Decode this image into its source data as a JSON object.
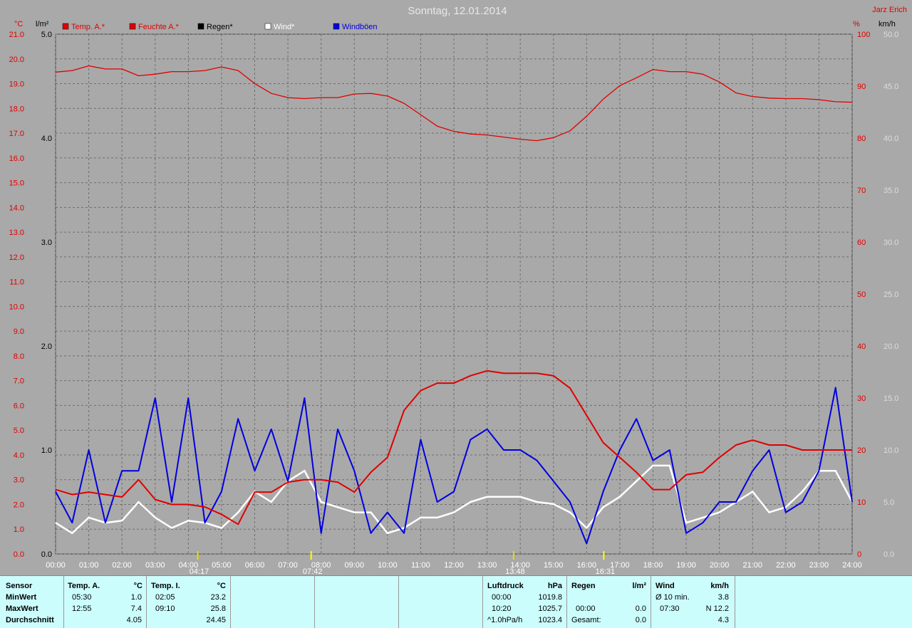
{
  "title": "Sonntag, 12.01.2014",
  "author": "Jarz Erich",
  "units": {
    "temp": "°C",
    "rain": "l/m²",
    "humidity": "%",
    "wind": "km/h"
  },
  "legend": [
    {
      "label": "Temp. A.*",
      "color": "#e00000"
    },
    {
      "label": "Feuchte A.*",
      "color": "#e00000"
    },
    {
      "label": "Regen*",
      "color": "#000000"
    },
    {
      "label": "Wind*",
      "color": "#ffffff"
    },
    {
      "label": "Windböen",
      "color": "#0000e0"
    }
  ],
  "markers": {
    "moonrise": "04:17",
    "sunrise": "07:42",
    "moonset": "13:48",
    "sunset": "16:31"
  },
  "chart_data": {
    "type": "line",
    "x_ticks": [
      "00:00",
      "01:00",
      "02:00",
      "03:00",
      "04:00",
      "05:00",
      "06:00",
      "07:00",
      "08:00",
      "09:00",
      "10:00",
      "11:00",
      "12:00",
      "13:00",
      "14:00",
      "15:00",
      "16:00",
      "17:00",
      "18:00",
      "19:00",
      "20:00",
      "21:00",
      "22:00",
      "23:00",
      "24:00"
    ],
    "axes": {
      "temp": {
        "min": 0,
        "max": 21,
        "step": 1,
        "ticks": [
          "0.0",
          "1.0",
          "2.0",
          "3.0",
          "4.0",
          "5.0",
          "6.0",
          "7.0",
          "8.0",
          "9.0",
          "10.0",
          "11.0",
          "12.0",
          "13.0",
          "14.0",
          "15.0",
          "16.0",
          "17.0",
          "18.0",
          "19.0",
          "20.0",
          "21.0"
        ]
      },
      "rain": {
        "min": 0,
        "max": 5,
        "ticks": [
          "0.0",
          "1.0",
          "2.0",
          "3.0",
          "4.0",
          "5.0"
        ]
      },
      "humidity": {
        "min": 0,
        "max": 100,
        "ticks": [
          "0",
          "10",
          "20",
          "30",
          "40",
          "50",
          "60",
          "70",
          "80",
          "90",
          "100"
        ]
      },
      "wind": {
        "min": 0,
        "max": 50,
        "ticks": [
          "0.0",
          "5.0",
          "10.0",
          "15.0",
          "20.0",
          "25.0",
          "30.0",
          "35.0",
          "40.0",
          "45.0",
          "50.0"
        ]
      }
    },
    "series": [
      {
        "name": "Temp. A.*",
        "axis": "temp",
        "color": "#e00000",
        "x": [
          0,
          0.5,
          1,
          1.5,
          2,
          2.5,
          3,
          3.5,
          4,
          4.5,
          5,
          5.5,
          6,
          6.5,
          7,
          7.5,
          8,
          8.5,
          9,
          9.5,
          10,
          10.5,
          11,
          11.5,
          12,
          12.5,
          13,
          13.5,
          14,
          14.5,
          15,
          15.5,
          16,
          16.5,
          17,
          17.5,
          18,
          18.5,
          19,
          19.5,
          20,
          20.5,
          21,
          21.5,
          22,
          22.5,
          23,
          23.5,
          24
        ],
        "values": [
          2.6,
          2.4,
          2.5,
          2.4,
          2.3,
          3.0,
          2.2,
          2.0,
          2.0,
          1.9,
          1.6,
          1.2,
          2.5,
          2.5,
          2.9,
          3.0,
          3.0,
          2.9,
          2.5,
          3.3,
          3.9,
          5.8,
          6.6,
          6.9,
          6.9,
          7.2,
          7.4,
          7.3,
          7.3,
          7.3,
          7.2,
          6.7,
          5.6,
          4.5,
          3.9,
          3.3,
          2.6,
          2.6,
          3.2,
          3.3,
          3.9,
          4.4,
          4.6,
          4.4,
          4.4,
          4.2,
          4.2,
          4.2,
          4.2
        ]
      },
      {
        "name": "Feuchte A.*",
        "axis": "humidity",
        "color": "#e00000",
        "x": [
          0,
          0.5,
          1,
          1.5,
          2,
          2.5,
          3,
          3.5,
          4,
          4.5,
          5,
          5.5,
          6,
          6.5,
          7,
          7.5,
          8,
          8.5,
          9,
          9.5,
          10,
          10.5,
          11,
          11.5,
          12,
          12.5,
          13,
          13.5,
          14,
          14.5,
          15,
          15.5,
          16,
          16.5,
          17,
          17.5,
          18,
          18.5,
          19,
          19.5,
          20,
          20.5,
          21,
          21.5,
          22,
          22.5,
          23,
          23.5,
          24
        ],
        "values": [
          92.7,
          93,
          93.9,
          93.3,
          93.3,
          92,
          92.3,
          92.8,
          92.8,
          93,
          93.7,
          93,
          90.5,
          88.6,
          87.8,
          87.6,
          87.8,
          87.8,
          88.5,
          88.6,
          88.1,
          86.7,
          84.5,
          82.3,
          81.3,
          80.8,
          80.6,
          80.2,
          79.8,
          79.5,
          80.1,
          81.4,
          84.2,
          87.5,
          90.1,
          91.6,
          93.2,
          92.8,
          92.8,
          92.3,
          90.8,
          88.7,
          88.0,
          87.7,
          87.6,
          87.6,
          87.4,
          87.0,
          86.9
        ]
      },
      {
        "name": "Wind*",
        "axis": "wind",
        "color": "#ffffff",
        "x": [
          0,
          0.5,
          1,
          1.5,
          2,
          2.5,
          3,
          3.5,
          4,
          4.5,
          5,
          5.5,
          6,
          6.5,
          7,
          7.5,
          8,
          8.5,
          9,
          9.5,
          10,
          10.5,
          11,
          11.5,
          12,
          12.5,
          13,
          13.5,
          14,
          14.5,
          15,
          15.5,
          16,
          16.5,
          17,
          17.5,
          18,
          18.5,
          19,
          19.5,
          20,
          20.5,
          21,
          21.5,
          22,
          22.5,
          23,
          23.5,
          24
        ],
        "values": [
          3,
          2,
          3.5,
          3,
          3.2,
          5,
          3.5,
          2.5,
          3.2,
          3,
          2.5,
          4,
          6,
          5,
          7,
          8,
          5,
          4.5,
          4,
          4,
          2,
          2.5,
          3.5,
          3.5,
          4,
          5,
          5.5,
          5.5,
          5.5,
          5,
          4.8,
          4,
          2.5,
          4.5,
          5.5,
          7,
          8.5,
          8.5,
          3,
          3.5,
          4,
          5,
          6,
          4,
          4.5,
          6,
          8,
          8,
          5
        ]
      },
      {
        "name": "Windböen",
        "axis": "wind",
        "color": "#0000e0",
        "x": [
          0,
          0.5,
          1,
          1.5,
          2,
          2.5,
          3,
          3.5,
          4,
          4.5,
          5,
          5.5,
          6,
          6.5,
          7,
          7.5,
          8,
          8.5,
          9,
          9.5,
          10,
          10.5,
          11,
          11.5,
          12,
          12.5,
          13,
          13.5,
          14,
          14.5,
          15,
          15.5,
          16,
          16.5,
          17,
          17.5,
          18,
          18.5,
          19,
          19.5,
          20,
          20.5,
          21,
          21.5,
          22,
          22.5,
          23,
          23.5,
          24
        ],
        "values": [
          6,
          3,
          10,
          3,
          8,
          8,
          15,
          5,
          15,
          3,
          6,
          13,
          8,
          12,
          7,
          15,
          2,
          12,
          8,
          2,
          4,
          2,
          11,
          5,
          6,
          11,
          12,
          10,
          10,
          9,
          7,
          5,
          1,
          6,
          10,
          13,
          9,
          10,
          2,
          3,
          5,
          5,
          8,
          10,
          4,
          5,
          8,
          16,
          5
        ]
      }
    ]
  },
  "table": {
    "sensor": {
      "header": "Sensor",
      "rows": [
        "MinWert",
        "MaxWert",
        "Durchschnitt"
      ]
    },
    "temp_a": {
      "header": "Temp. A.",
      "unit": "°C",
      "min_time": "05:30",
      "min": "1.0",
      "max_time": "12:55",
      "max": "7.4",
      "avg": "4.05"
    },
    "temp_i": {
      "header": "Temp. I.",
      "unit": "°C",
      "min_time": "02:05",
      "min": "23.2",
      "max_time": "09:10",
      "max": "25.8",
      "avg": "24.45"
    },
    "luftdruck": {
      "header": "Luftdruck",
      "unit": "hPa",
      "r1_label": "00:00",
      "r1": "1019.8",
      "r2_label": "10:20",
      "r2": "1025.7",
      "r3_label": "^1.0hPa/h",
      "r3": "1023.4"
    },
    "regen": {
      "header": "Regen",
      "unit": "l/m²",
      "r2_label": "00:00",
      "r2": "0.0",
      "r3_label": "Gesamt:",
      "r3": "0.0"
    },
    "wind": {
      "header": "Wind",
      "unit": "km/h",
      "r1_label": "Ø 10 min.",
      "r1": "3.8",
      "r2_label": "07:30",
      "r2": "N 12.2",
      "r3": "4.3"
    }
  }
}
